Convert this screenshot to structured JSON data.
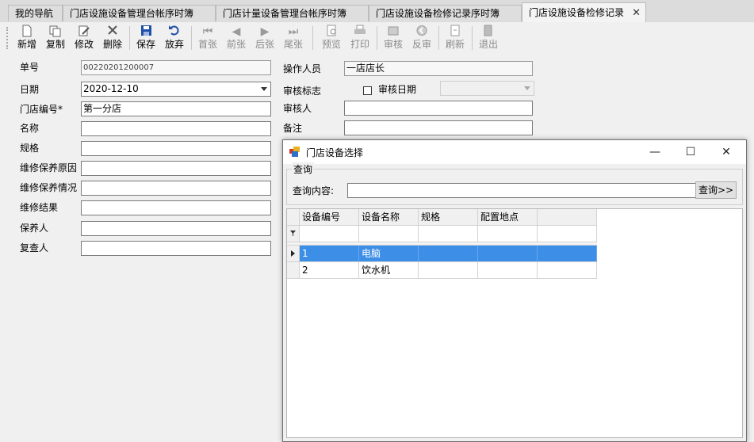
{
  "tabs": [
    {
      "label": "我的导航"
    },
    {
      "label": "门店设施设备管理台帐序时簿"
    },
    {
      "label": "门店计量设备管理台帐序时簿"
    },
    {
      "label": "门店设施设备检修记录序时簿"
    },
    {
      "label": "门店设施设备检修记录",
      "active": true
    }
  ],
  "toolbar": {
    "new": "新增",
    "copy": "复制",
    "edit": "修改",
    "delete": "删除",
    "save": "保存",
    "discard": "放弃",
    "first": "首张",
    "prev": "前张",
    "next": "后张",
    "last": "尾张",
    "preview": "预览",
    "print": "打印",
    "approve": "审核",
    "unapprove": "反审",
    "refresh": "刷新",
    "exit": "退出"
  },
  "form": {
    "doc_no_label": "单号",
    "doc_no": "00220201200007",
    "date_label": "日期",
    "date": "2020-12-10",
    "store_no_label": "门店编号*",
    "store_no": "第一分店",
    "name_label": "名称",
    "spec_label": "规格",
    "reason_label": "维修保养原因",
    "status_label": "维修保养情况",
    "result_label": "维修结果",
    "maintainer_label": "保养人",
    "reviewer_label": "复查人",
    "operator_label": "操作人员",
    "operator": "一店店长",
    "audit_flag_label": "审核标志",
    "audit_date_label": "审核日期",
    "auditor_label": "审核人",
    "remark_label": "备注"
  },
  "dialog": {
    "title": "门店设备选择",
    "group_title": "查询",
    "query_label": "查询内容:",
    "query_value": "",
    "query_button": "查询>>",
    "columns": [
      "设备编号",
      "设备名称",
      "规格",
      "配置地点"
    ],
    "rows": [
      {
        "code": "1",
        "name": "电脑",
        "spec": "",
        "location": ""
      },
      {
        "code": "2",
        "name": "饮水机",
        "spec": "",
        "location": ""
      }
    ]
  },
  "colors": {
    "selection": "#3d8ee6",
    "save_icon": "#1f4fa8"
  }
}
